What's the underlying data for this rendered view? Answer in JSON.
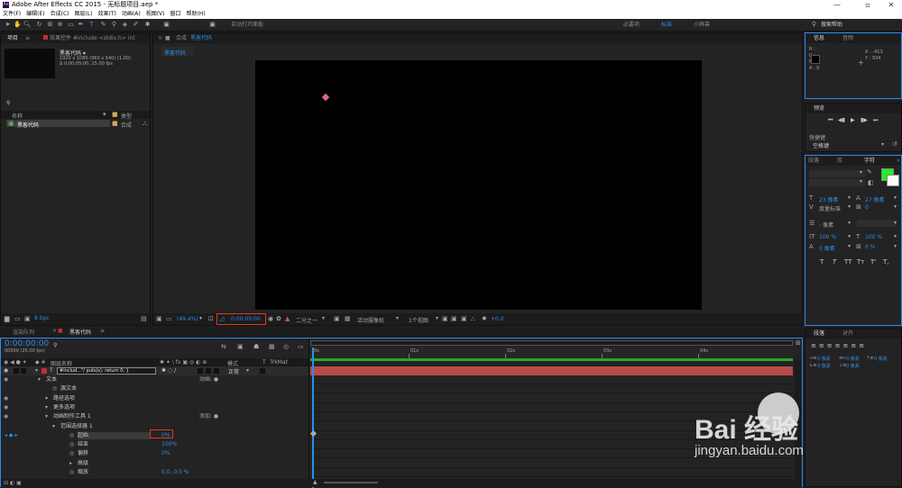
{
  "window": {
    "title": "Adobe After Effects CC 2015 - 无标题项目.aep *"
  },
  "menu": [
    "文件(F)",
    "编辑(E)",
    "合成(C)",
    "图层(L)",
    "效果(T)",
    "动画(A)",
    "视图(V)",
    "窗口",
    "帮助(H)"
  ],
  "toolbar": {
    "auto_open_label": "自动打开面板",
    "workspaces": [
      "必要项",
      "标准",
      "小屏幕"
    ],
    "search_placeholder": "搜索帮助"
  },
  "project_panel": {
    "tab_label": "项目",
    "tab2_label": "效果控件 #include <stdio.h> int",
    "comp_name": "黑客代码 ▾",
    "comp_info1": "1920 x 1080 (960 x 540) (1.00)",
    "comp_info2": "Δ 0:00:05:00, 25.00 fps",
    "col_name": "名称",
    "col_type": "类型",
    "item_name": "黑客代码",
    "item_type": "合成",
    "bpc": "8 bpc"
  },
  "comp_panel": {
    "tab_label": "合成",
    "tab_name": "黑客代码",
    "sub_tab": "黑客代码",
    "zoom": "(49.4%)",
    "time": "0:00:00:00",
    "resolution": "二分之一",
    "camera": "活动摄像机",
    "views": "1个视图",
    "exposure": "+0.0"
  },
  "info_panel": {
    "tab1": "信息",
    "tab2": "音频",
    "r": "R :",
    "g": "G :",
    "b": "B :",
    "a": "A : 0",
    "x": "X : -413",
    "y": "Y : 934"
  },
  "preview_panel": {
    "tab": "预览",
    "shortcut_label": "快捷键",
    "shortcut_value": "空格键"
  },
  "character_panel": {
    "tabs": [
      "段落",
      "库",
      "字符"
    ],
    "font_size": "23 像素",
    "leading": "27 像素",
    "kerning": "度量标准",
    "tracking": "0",
    "stroke": "- 像素",
    "vscale": "100 %",
    "hscale": "100 %",
    "baseline": "0 像素",
    "tsume": "0 %",
    "styles": [
      "T",
      "T",
      "TT",
      "Tт",
      "T'",
      "T,"
    ]
  },
  "paragraph_panel": {
    "tabs": [
      "段落",
      "对齐"
    ],
    "values": [
      "0 像素",
      "0 像素",
      "0 像素",
      "0 像素",
      "0 像素"
    ]
  },
  "timeline": {
    "tab1": "渲染队列",
    "tab2": "黑客代码",
    "timecode": "0:00:00:00",
    "fps": "00000 (25.00 fps)",
    "col_layer": "图层名称",
    "col_mode": "模式",
    "col_t": "T",
    "col_trkmat": "TrkMat",
    "layer_name": "#includ...\"/    puts(s);    return 0; }",
    "layer_mode": "正常",
    "rows": [
      {
        "label": "文本",
        "right": "动画: ●",
        "indent": 50
      },
      {
        "label": "源文本",
        "right": "",
        "indent": 66
      },
      {
        "label": "路径选项",
        "right": "",
        "indent": 58
      },
      {
        "label": "更多选项",
        "right": "",
        "indent": 58
      },
      {
        "label": "动画制作工具 1",
        "right": "添加: ●",
        "indent": 58
      },
      {
        "label": "范围选择器 1",
        "right": "",
        "indent": 66
      },
      {
        "label": "起始",
        "right": "",
        "value": "0%",
        "indent": 85
      },
      {
        "label": "结束",
        "right": "",
        "value": "100%",
        "indent": 85
      },
      {
        "label": "偏移",
        "right": "",
        "value": "0%",
        "indent": 85
      },
      {
        "label": "高级",
        "right": "",
        "indent": 85
      },
      {
        "label": "缩放",
        "right": "",
        "value": "0.0, 0.0 %",
        "indent": 85
      }
    ],
    "ruler": [
      "0s",
      "01s",
      "02s",
      "03s",
      "04s"
    ]
  },
  "watermark": {
    "text": "Bai 经验",
    "url": "jingyan.baidu.com"
  }
}
